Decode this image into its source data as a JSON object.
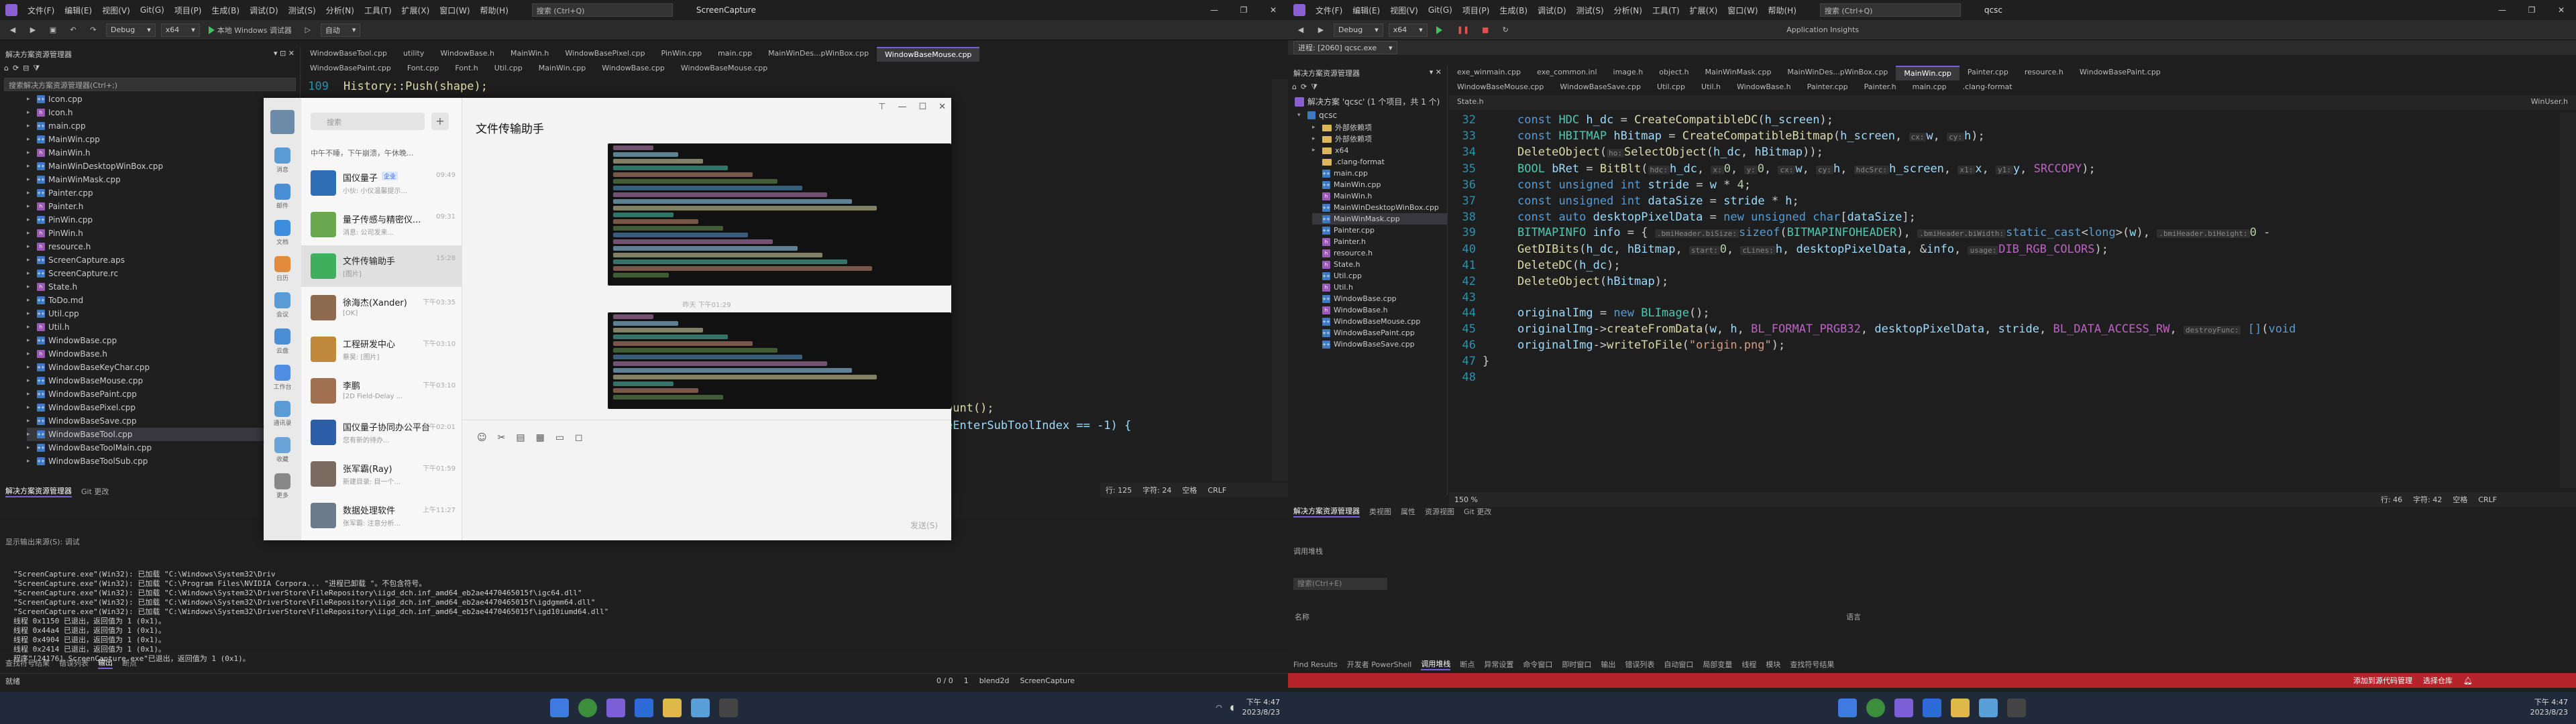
{
  "left": {
    "menu": [
      "文件(F)",
      "编辑(E)",
      "视图(V)",
      "Git(G)",
      "项目(P)",
      "生成(B)",
      "调试(D)",
      "测试(S)",
      "分析(N)",
      "工具(T)",
      "扩展(X)",
      "窗口(W)",
      "帮助(H)"
    ],
    "search_placeholder": "搜索 (Ctrl+Q)",
    "app_title": "ScreenCapture",
    "toolbar": {
      "config": "Debug",
      "platform": "x64",
      "run": "本地 Windows 调试器",
      "mode": "自动"
    },
    "solution_explorer": {
      "title": "解决方案资源管理器",
      "search_placeholder": "搜索解决方案资源管理器(Ctrl+;)",
      "items": [
        "Icon.cpp",
        "Icon.h",
        "main.cpp",
        "MainWin.cpp",
        "MainWin.h",
        "MainWinDesktopWinBox.cpp",
        "MainWinMask.cpp",
        "Painter.cpp",
        "Painter.h",
        "PinWin.cpp",
        "PinWin.h",
        "resource.h",
        "ScreenCapture.aps",
        "ScreenCapture.rc",
        "State.h",
        "ToDo.md",
        "Util.cpp",
        "Util.h",
        "WindowBase.cpp",
        "WindowBase.h",
        "WindowBaseKeyChar.cpp",
        "WindowBaseMouse.cpp",
        "WindowBasePaint.cpp",
        "WindowBasePixel.cpp",
        "WindowBaseSave.cpp",
        "WindowBaseTool.cpp",
        "WindowBaseToolMain.cpp",
        "WindowBaseToolSub.cpp"
      ],
      "selected_index": 25
    },
    "panel_tabs": [
      "解决方案资源管理器",
      "Git 更改"
    ],
    "tabs_row1": [
      "WindowBaseTool.cpp",
      "utility",
      "WindowBase.h",
      "MainWin.h",
      "WindowBasePixel.cpp",
      "PinWin.cpp",
      "main.cpp",
      "MainWinDes...pWinBox.cpp",
      "WindowBaseMouse.cpp"
    ],
    "tabs_row2": [
      "WindowBasePaint.cpp",
      "Font.cpp",
      "Font.h",
      "Util.cpp",
      "MainWin.cpp",
      "WindowBase.cpp",
      "WindowBaseMouse.cpp"
    ],
    "active_tab": "WindowBaseMouse.cpp",
    "code_line_no": "109",
    "code_line": "History::Push(shape);",
    "code_frag1": "ount();",
    "code_frag2": "eEnterSubToolIndex == -1) {",
    "editor_status": {
      "line": "行: 125",
      "col": "字符: 24",
      "ins": "空格",
      "eol": "CRLF"
    },
    "output": {
      "title": "显示输出来源(S): 调试",
      "lines": [
        "\"ScreenCapture.exe\"(Win32): 已加载 \"C:\\Windows\\System32\\Driv",
        "\"ScreenCapture.exe\"(Win32): 已加载 \"C:\\Program Files\\NVIDIA Corpora... \"进程已卸载 \"。不包含符号。",
        "\"ScreenCapture.exe\"(Win32): 已加载 \"C:\\Windows\\System32\\DriverStore\\FileRepository\\iigd_dch.inf_amd64_eb2ae4470465015f\\igc64.dll\"",
        "\"ScreenCapture.exe\"(Win32): 已加载 \"C:\\Windows\\System32\\DriverStore\\FileRepository\\iigd_dch.inf_amd64_eb2ae4470465015f\\igdgmm64.dll\"",
        "\"ScreenCapture.exe\"(Win32): 已加载 \"C:\\Windows\\System32\\DriverStore\\FileRepository\\iigd_dch.inf_amd64_eb2ae4470465015f\\igd10iumd64.dll\"",
        "线程 0x1150 已退出，返回值为 1 (0x1)。",
        "线程 0x44a4 已退出，返回值为 1 (0x1)。",
        "线程 0x4904 已退出，返回值为 1 (0x1)。",
        "线程 0x2414 已退出，返回值为 1 (0x1)。",
        "程序\"[24176] ScreenCapture.exe\"已退出，返回值为 1 (0x1)。"
      ],
      "bottom_tabs": [
        "查找符号结果",
        "错误列表",
        "输出",
        "断点"
      ]
    },
    "statusbar": {
      "ready": "就绪",
      "errs": "0 / 0",
      "warn": "1",
      "branch": "blend2d",
      "repo": "ScreenCapture"
    },
    "colors": {
      "status": "#1f1f1f"
    }
  },
  "chat": {
    "title": "文件传输助手",
    "search_placeholder": "搜索",
    "notice": "中午不睡，下午崩溃，午休晚...",
    "rail_labels": [
      "消息",
      "邮件",
      "文档",
      "日历",
      "会议",
      "云盘",
      "工作台",
      "通讯录",
      "收藏",
      "更多"
    ],
    "conversations": [
      {
        "name": "国仪量子",
        "tag": "企业",
        "preview": "小伙: 小仪温馨提示...",
        "time": "09:49"
      },
      {
        "name": "量子传感与精密仪...",
        "preview": "消息: 公司发来...",
        "time": "09:31"
      },
      {
        "name": "文件传输助手",
        "preview": "[图片]",
        "time": "15:28"
      },
      {
        "name": "徐海杰(Xander)",
        "preview": "[OK]",
        "time": "下午03:35"
      },
      {
        "name": "工程研发中心",
        "preview": "蔡昊: [图片]",
        "time": "下午03:10"
      },
      {
        "name": "李鹏",
        "preview": "[2D Field-Delay ...",
        "time": "下午03:10"
      },
      {
        "name": "国仪量子协同办公平台",
        "preview": "您有新的待办...",
        "time": "下午02:01"
      },
      {
        "name": "张军霸(Ray)",
        "preview": "新建目录: 目一个...",
        "time": "下午01:59"
      },
      {
        "name": "数据处理软件",
        "preview": "张军霸: 注意分析...",
        "time": "上午11:27"
      }
    ],
    "selected": 2,
    "time_divider": "昨天 下午01:29",
    "send_label": "发送(S)"
  },
  "right": {
    "menu": [
      "文件(F)",
      "编辑(E)",
      "视图(V)",
      "Git(G)",
      "项目(P)",
      "生成(B)",
      "调试(D)",
      "测试(S)",
      "分析(N)",
      "工具(T)",
      "扩展(X)",
      "窗口(W)",
      "帮助(H)"
    ],
    "search_placeholder": "搜索 (Ctrl+Q)",
    "app_title": "qcsc",
    "insights": "Application Insights",
    "process": "进程: [2060] qcsc.exe",
    "solution_explorer": {
      "title": "解决方案资源管理器",
      "root": "解决方案 'qcsc' (1 个项目，共 1 个)",
      "project": "qcsc",
      "items": [
        "外部依赖项",
        "外部依赖项",
        "x64",
        ".clang-format",
        "main.cpp",
        "MainWin.cpp",
        "MainWin.h",
        "MainWinDesktopWinBox.cpp",
        "MainWinMask.cpp",
        "Painter.cpp",
        "Painter.h",
        "resource.h",
        "State.h",
        "Util.cpp",
        "Util.h",
        "WindowBase.cpp",
        "WindowBase.h",
        "WindowBaseMouse.cpp",
        "WindowBasePaint.cpp",
        "WindowBaseSave.cpp"
      ],
      "selected_index": 8
    },
    "panel_tabs": [
      "解决方案资源管理器",
      "类视图",
      "属性",
      "资源视图",
      "Git 更改"
    ],
    "tabs_row1": [
      "exe_winmain.cpp",
      "exe_common.inl",
      "image.h",
      "object.h",
      "MainWinMask.cpp",
      "MainWinDes...pWinBox.cpp",
      "MainWin.cpp",
      "Painter.cpp",
      "resource.h",
      "WindowBasePaint.cpp"
    ],
    "tabs_row2": [
      "WindowBaseMouse.cpp",
      "WindowBaseSave.cpp",
      "Util.cpp",
      "Util.h",
      "WindowBase.h",
      "Painter.cpp",
      "Painter.h",
      "main.cpp",
      ".clang-format"
    ],
    "active_tab": "MainWin.cpp",
    "nav_left": "State.h",
    "nav_right": "WinUser.h",
    "code_start": 32,
    "editor_status": {
      "zoom": "150 %",
      "line": "行: 46",
      "col": "字符: 42",
      "ins": "空格",
      "eol": "CRLF"
    },
    "output": {
      "title": "调用堆栈",
      "search_placeholder": "搜索(Ctrl+E)",
      "col_name": "名称",
      "col_lang": "语言"
    },
    "bottom_tabs": [
      "Find Results",
      "开发者 PowerShell",
      "调用堆栈",
      "断点",
      "异常设置",
      "命令窗口",
      "即时窗口",
      "输出",
      "错误列表",
      "自动窗口",
      "局部变量",
      "线程",
      "模块",
      "查找符号结果"
    ],
    "statusbar": {
      "left": "添加到源代码管理",
      "right": "选择仓库"
    },
    "colors": {
      "status": "#b5232b"
    }
  },
  "taskbar": {
    "time_left": "下午 4:47",
    "date_left": "2023/8/23",
    "time_right": "下午 4:47",
    "date_right": "2023/8/23"
  }
}
